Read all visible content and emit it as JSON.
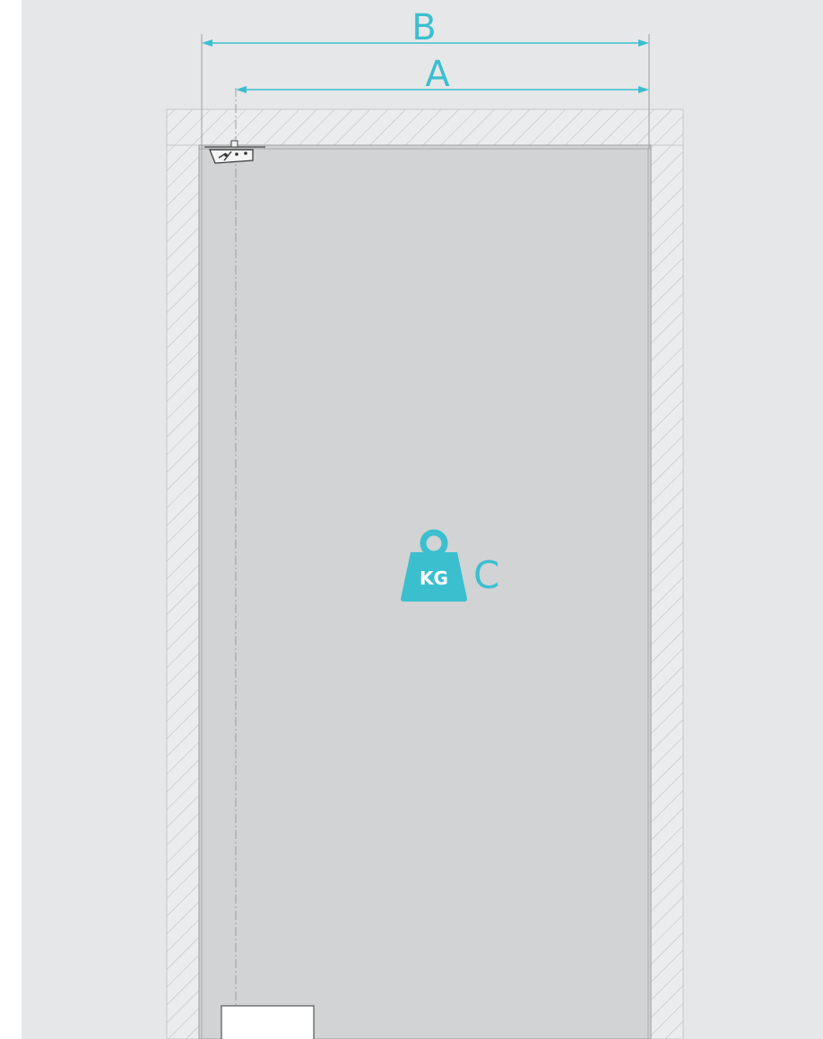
{
  "dimensions": {
    "outer_width_label": "B",
    "inner_width_label": "A"
  },
  "weight": {
    "icon_text": "KG",
    "label": "C"
  },
  "icons": {
    "weight": "weight-icon",
    "hinge": "top-pivot-hinge-icon"
  },
  "colors": {
    "accent": "#3bbfcf",
    "background": "#e6e7e8",
    "door_panel": "#d1d3d4",
    "frame": "#ebeced",
    "hatch": "#b8babc",
    "line": "#9a9c9e"
  }
}
